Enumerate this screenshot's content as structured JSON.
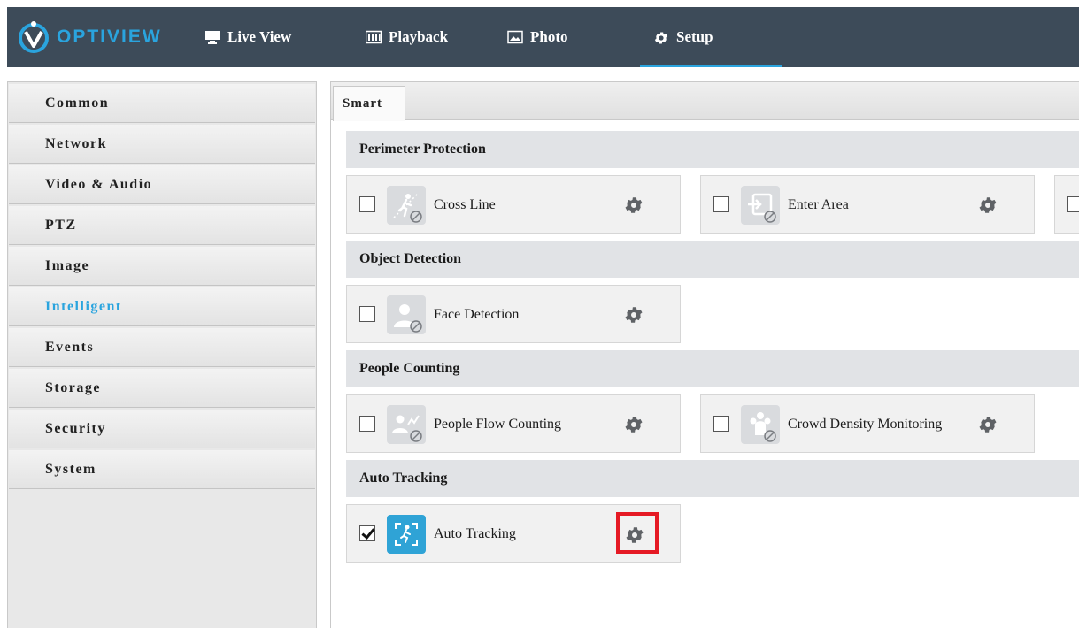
{
  "brand": {
    "logo_text": "OPTIVIEW",
    "accent": "#2aa4de",
    "highlight": "#e51a24"
  },
  "nav": {
    "items": [
      {
        "label": "Live View",
        "icon": "monitor-icon"
      },
      {
        "label": "Playback",
        "icon": "film-icon"
      },
      {
        "label": "Photo",
        "icon": "photo-icon"
      },
      {
        "label": "Setup",
        "icon": "gear-icon",
        "active": true
      }
    ]
  },
  "sidebar": {
    "items": [
      {
        "label": "Common"
      },
      {
        "label": "Network"
      },
      {
        "label": "Video & Audio"
      },
      {
        "label": "PTZ"
      },
      {
        "label": "Image"
      },
      {
        "label": "Intelligent",
        "active": true
      },
      {
        "label": "Events"
      },
      {
        "label": "Storage"
      },
      {
        "label": "Security"
      },
      {
        "label": "System"
      }
    ]
  },
  "tabs": [
    {
      "label": "Smart",
      "active": true
    }
  ],
  "sections": [
    {
      "title": "Perimeter Protection",
      "functions": [
        {
          "label": "Cross Line",
          "checked": false,
          "icon": "cross-line-icon"
        },
        {
          "label": "Enter Area",
          "checked": false,
          "icon": "enter-area-icon"
        },
        {
          "label": "",
          "checked": false
        }
      ]
    },
    {
      "title": "Object Detection",
      "functions": [
        {
          "label": "Face Detection",
          "checked": false,
          "icon": "face-detection-icon"
        }
      ]
    },
    {
      "title": "People Counting",
      "functions": [
        {
          "label": "People Flow Counting",
          "checked": false,
          "icon": "people-flow-icon"
        },
        {
          "label": "Crowd Density Monitoring",
          "checked": false,
          "icon": "crowd-density-icon"
        }
      ]
    },
    {
      "title": "Auto Tracking",
      "functions": [
        {
          "label": "Auto Tracking",
          "checked": true,
          "icon": "auto-tracking-icon",
          "highlighted": true
        }
      ]
    }
  ]
}
